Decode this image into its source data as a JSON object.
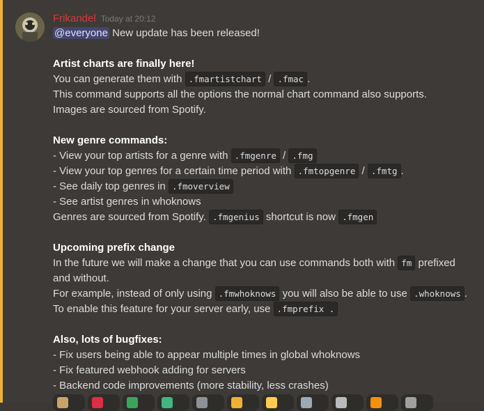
{
  "message": {
    "username": "Frikandel",
    "timestamp": "Today at 20:12",
    "mention": "@everyone",
    "intro": " New update has been released!",
    "s1_title": "Artist charts are finally here!",
    "s1_l1_a": "You can generate them with ",
    "s1_l1_c1": ".fmartistchart",
    "s1_l1_b": " / ",
    "s1_l1_c2": ".fmac",
    "s1_l1_c": ".",
    "s1_l2": "This command supports all the options the normal chart command also supports.",
    "s1_l3": "Images are sourced from Spotify.",
    "s2_title": "New genre commands:",
    "s2_l1_a": "- View your top artists for a genre with ",
    "s2_l1_c1": ".fmgenre",
    "s2_l1_b": " / ",
    "s2_l1_c2": ".fmg",
    "s2_l2_a": "- View your top genres for a certain time period with ",
    "s2_l2_c1": ".fmtopgenre",
    "s2_l2_b": " / ",
    "s2_l2_c2": ".fmtg",
    "s2_l2_c": ".",
    "s2_l3_a": "- See daily top genres in ",
    "s2_l3_c1": ".fmoverview",
    "s2_l4": "- See artist genres in whoknows",
    "s2_l5_a": "Genres are sourced from Spotify. ",
    "s2_l5_c1": ".fmgenius",
    "s2_l5_b": " shortcut is now ",
    "s2_l5_c2": ".fmgen",
    "s3_title": "Upcoming prefix change",
    "s3_l1_a": "In the future we will make a change that you can use commands both with ",
    "s3_l1_c1": "fm",
    "s3_l1_b": " prefixed",
    "s3_l2": "and without.",
    "s3_l3_a": "For example, instead of only using ",
    "s3_l3_c1": ".fmwhoknows",
    "s3_l3_b": " you will also be able to use ",
    "s3_l3_c2": ".whoknows",
    "s3_l3_c": ".",
    "s3_l4_a": "To enable this feature for your server early, use ",
    "s3_l4_c1": ".fmprefix .",
    "s4_title": "Also, lots of bugfixes:",
    "s4_l1": "- Fix users being able to appear multiple times in global whoknows",
    "s4_l2": "- Fix featured webhook adding for servers",
    "s4_l3": "- Backend code improvements (more stability, less crashes)"
  },
  "reactions": [
    {
      "icon": "reaction-emoji-1",
      "color": "#c9a36a"
    },
    {
      "icon": "heart-emoji",
      "color": "#dd2e44"
    },
    {
      "icon": "reaction-emoji-3",
      "color": "#3ba55c"
    },
    {
      "icon": "reaction-emoji-4",
      "color": "#43b581"
    },
    {
      "icon": "reaction-emoji-5",
      "color": "#8e9297"
    },
    {
      "icon": "reaction-emoji-6",
      "color": "#f0b132"
    },
    {
      "icon": "reaction-emoji-7",
      "color": "#ffcc4d"
    },
    {
      "icon": "reaction-emoji-8",
      "color": "#99aab5"
    },
    {
      "icon": "reaction-emoji-9",
      "color": "#b9bbbe"
    },
    {
      "icon": "reaction-emoji-10",
      "color": "#f4900c"
    },
    {
      "icon": "reaction-emoji-11",
      "color": "#a0a0a0"
    }
  ],
  "colors": {
    "background": "#3d3a37",
    "mention_highlight": "#f0b132",
    "username": "#d23c3c"
  }
}
